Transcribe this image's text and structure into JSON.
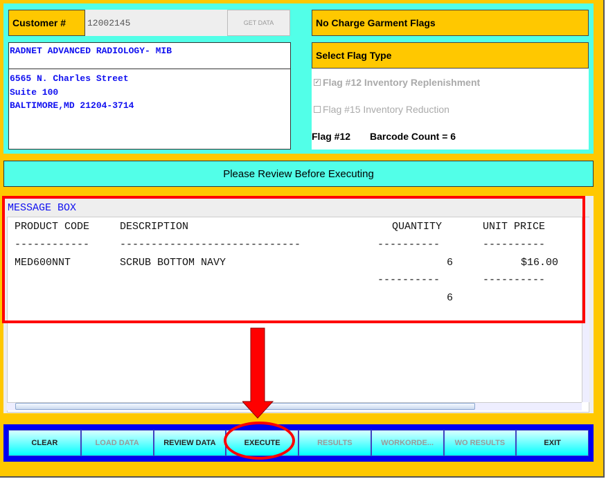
{
  "customer": {
    "label": "Customer #",
    "number": "12002145",
    "get_data": "GET DATA",
    "name": "RADNET ADVANCED RADIOLOGY- MIB",
    "address": [
      "6565 N. Charles Street",
      "Suite 100",
      "BALTIMORE,MD 21204-3714"
    ]
  },
  "flags": {
    "title": "No Charge Garment Flags",
    "select_label": "Select Flag Type",
    "options": [
      {
        "label": "Flag #12 Inventory Replenishment",
        "checked": true
      },
      {
        "label": "Flag #15 Inventory Reduction",
        "checked": false
      }
    ],
    "selected_flag": "Flag #12",
    "barcode_count": "Barcode Count = 6"
  },
  "review_banner": "Please Review Before Executing",
  "message_box": {
    "title": "MESSAGE BOX",
    "headers": [
      "PRODUCT CODE",
      "DESCRIPTION",
      "QUANTITY",
      "UNIT PRICE"
    ],
    "dashes": [
      "------------",
      "-----------------------------",
      "----------",
      "----------"
    ],
    "rows": [
      {
        "code": "MED600NNT",
        "description": "SCRUB BOTTOM NAVY",
        "quantity": "6",
        "price": "$16.00"
      }
    ],
    "total_dashes": [
      "----------",
      "----------"
    ],
    "total_quantity": "6"
  },
  "buttons": [
    {
      "label": "CLEAR",
      "enabled": true
    },
    {
      "label": "LOAD DATA",
      "enabled": false
    },
    {
      "label": "REVIEW DATA",
      "enabled": true
    },
    {
      "label": "EXECUTE",
      "enabled": true
    },
    {
      "label": "RESULTS",
      "enabled": false
    },
    {
      "label": "WORKORDE...",
      "enabled": false
    },
    {
      "label": "WO RESULTS",
      "enabled": false
    },
    {
      "label": "EXIT",
      "enabled": true
    }
  ],
  "annotation_color": "#FF0000"
}
